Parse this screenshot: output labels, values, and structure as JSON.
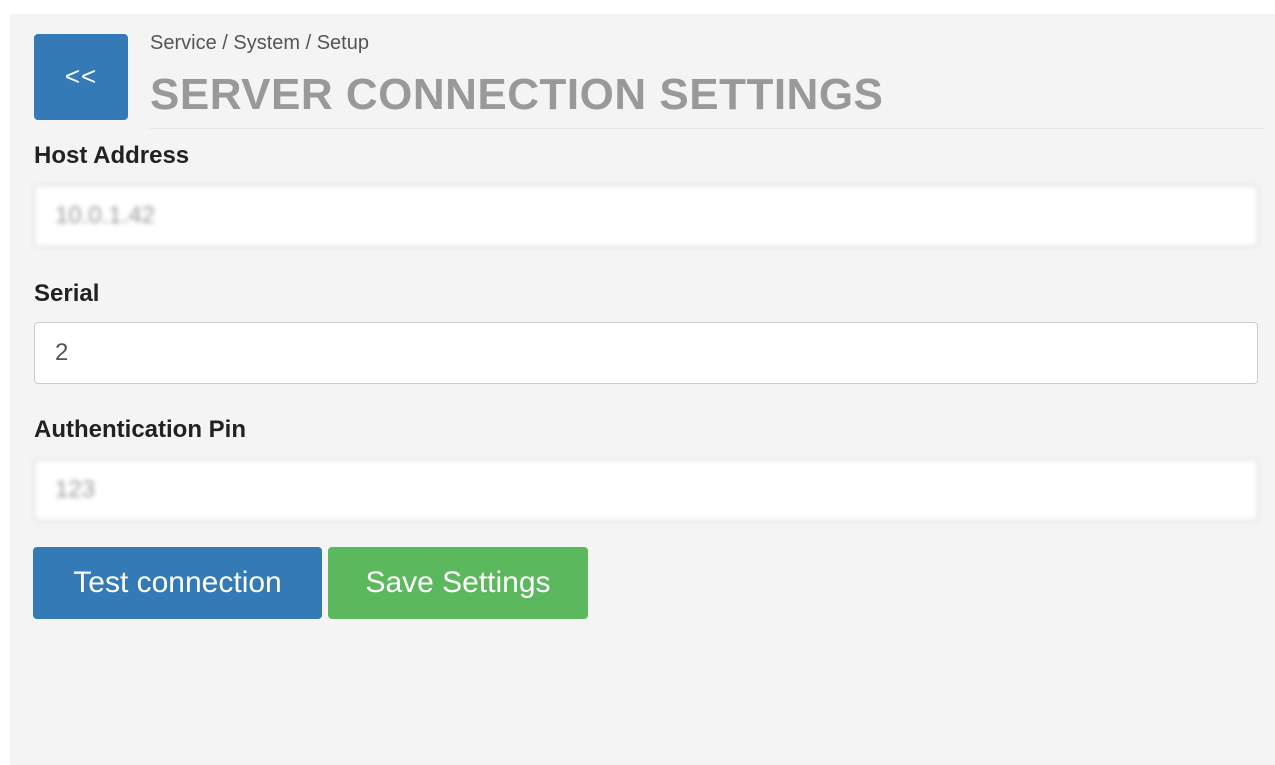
{
  "header": {
    "back_label": "<<",
    "breadcrumb": "Service / System / Setup",
    "title": "SERVER CONNECTION SETTINGS"
  },
  "form": {
    "host_address": {
      "label": "Host Address",
      "value": "10.0.1.42"
    },
    "serial": {
      "label": "Serial",
      "value": "2"
    },
    "auth_pin": {
      "label": "Authentication Pin",
      "value": "123"
    }
  },
  "actions": {
    "test_label": "Test connection",
    "save_label": "Save Settings"
  },
  "colors": {
    "primary": "#337ab7",
    "success": "#5cb85c",
    "title_gray": "#999999",
    "panel_bg": "#f4f4f4"
  }
}
